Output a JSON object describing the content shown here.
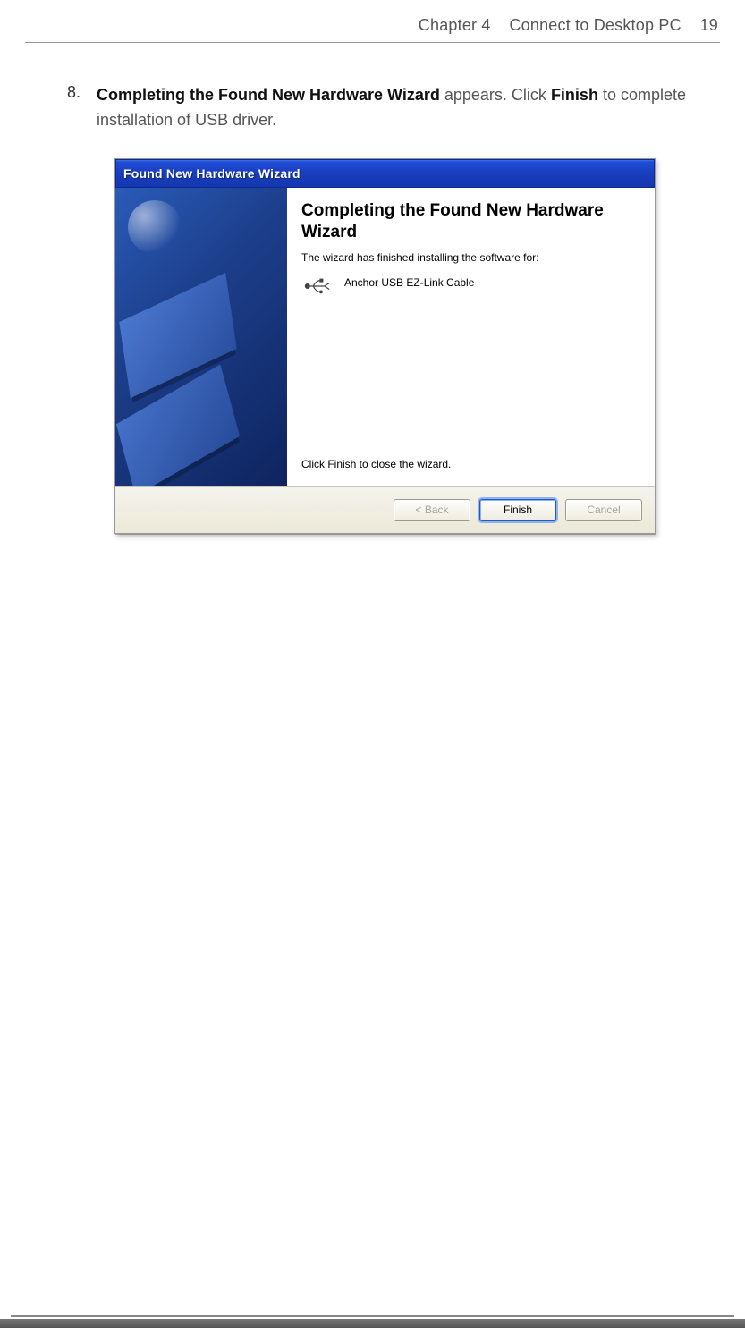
{
  "header": {
    "chapter_label": "Chapter 4",
    "section_title": "Connect to Desktop PC",
    "page_number": "19"
  },
  "step": {
    "number": "8.",
    "bold_intro": "Completing the Found New Hardware Wizard",
    "text_mid": " appears. Click ",
    "bold_finish": "Finish",
    "text_end": " to complete installation of USB driver."
  },
  "wizard": {
    "titlebar": "Found New Hardware Wizard",
    "heading": "Completing the Found New Hardware Wizard",
    "intro_text": "The wizard has finished installing the software for:",
    "device_name": "Anchor USB EZ-Link Cable",
    "close_text": "Click Finish to close the wizard.",
    "buttons": {
      "back": "< Back",
      "finish": "Finish",
      "cancel": "Cancel"
    }
  }
}
